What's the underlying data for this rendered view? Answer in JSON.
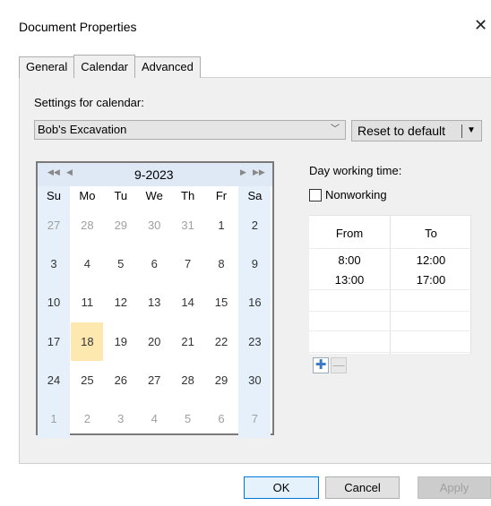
{
  "window": {
    "title": "Document Properties",
    "close_glyph": "✕"
  },
  "tabs": [
    {
      "label": "General",
      "active": false
    },
    {
      "label": "Calendar",
      "active": true
    },
    {
      "label": "Advanced",
      "active": false
    }
  ],
  "settings": {
    "label": "Settings for calendar:",
    "selected_calendar": "Bob's Excavation",
    "reset_label": "Reset to default"
  },
  "calendar": {
    "month_label": "9-2023",
    "weekdays": [
      "Su",
      "Mo",
      "Tu",
      "We",
      "Th",
      "Fr",
      "Sa"
    ],
    "weeks": [
      [
        "27",
        "28",
        "29",
        "30",
        "31",
        "1",
        "2"
      ],
      [
        "3",
        "4",
        "5",
        "6",
        "7",
        "8",
        "9"
      ],
      [
        "10",
        "11",
        "12",
        "13",
        "14",
        "15",
        "16"
      ],
      [
        "17",
        "18",
        "19",
        "20",
        "21",
        "22",
        "23"
      ],
      [
        "24",
        "25",
        "26",
        "27",
        "28",
        "29",
        "30"
      ],
      [
        "1",
        "2",
        "3",
        "4",
        "5",
        "6",
        "7"
      ]
    ],
    "today": "18"
  },
  "working_time": {
    "label": "Day working time:",
    "nonworking_label": "Nonworking",
    "nonworking_checked": false,
    "col_from": "From",
    "col_to": "To",
    "rows": [
      {
        "from": "8:00",
        "to": "12:00"
      },
      {
        "from": "13:00",
        "to": "17:00"
      }
    ]
  },
  "buttons": {
    "ok": "OK",
    "cancel": "Cancel",
    "apply": "Apply"
  },
  "colors": {
    "weekend_bg": "#e6f0fa",
    "today_bg": "#fde9b0",
    "header_bg": "#dfe8f5",
    "focus_border": "#0078d7"
  }
}
